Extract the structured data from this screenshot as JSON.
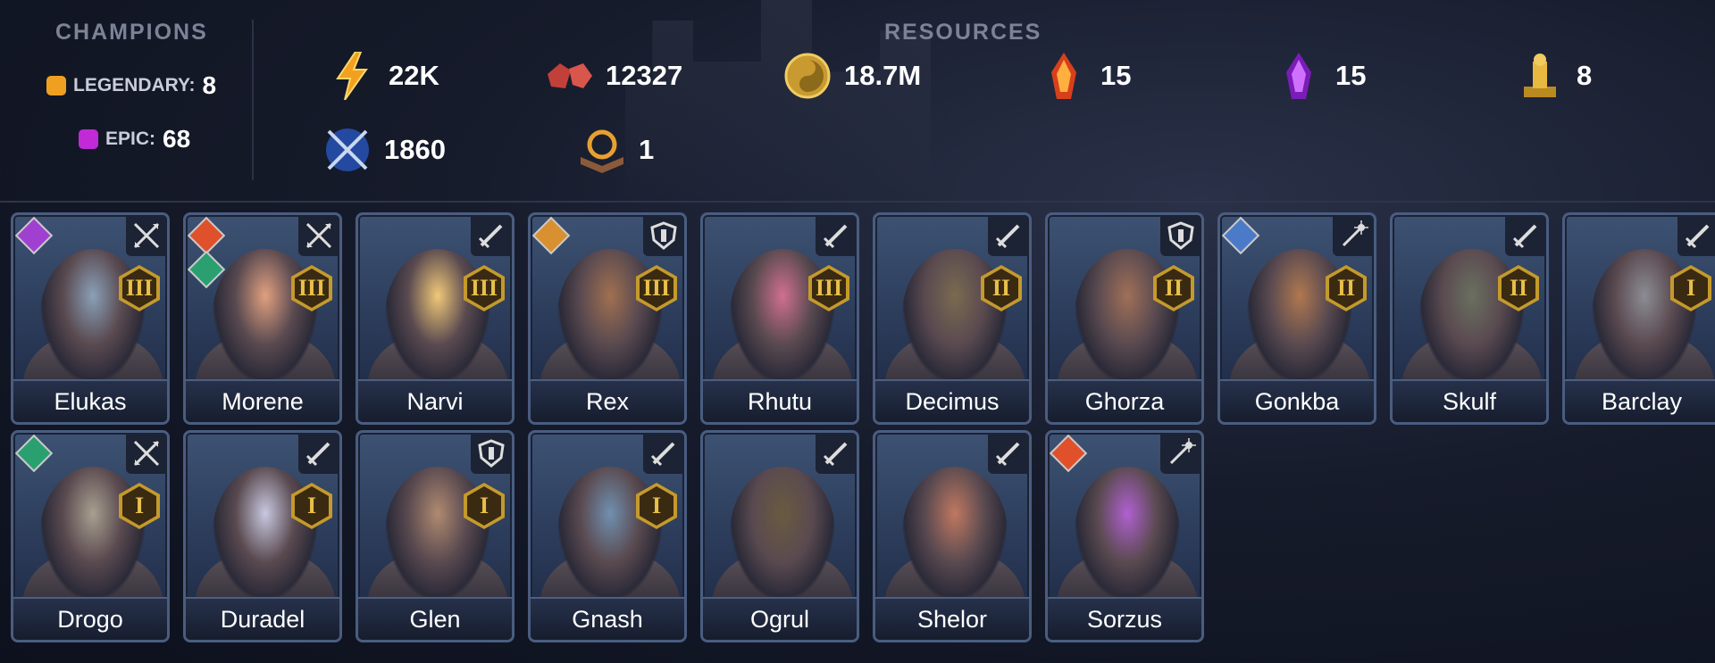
{
  "champions": {
    "title": "CHAMPIONS",
    "legendary_label": "LEGENDARY:",
    "legendary_count": "8",
    "epic_label": "EPIC:",
    "epic_count": "68",
    "legendary_color": "#f0a020",
    "epic_color": "#c22ad8"
  },
  "resources": {
    "title": "RESOURCES",
    "items": [
      {
        "icon": "energy-lightning-icon",
        "value": "22K"
      },
      {
        "icon": "gems-icon",
        "value": "12327"
      },
      {
        "icon": "silver-coin-icon",
        "value": "18.7M"
      },
      {
        "icon": "fire-shard-icon",
        "value": "15"
      },
      {
        "icon": "purple-shard-icon",
        "value": "15"
      },
      {
        "icon": "gold-statue-icon",
        "value": "8"
      },
      {
        "icon": "arena-token-icon",
        "value": "1860"
      },
      {
        "icon": "tome-icon",
        "value": "1"
      }
    ]
  },
  "cards": [
    {
      "name": "Elukas",
      "rank": "III",
      "role": "attack-icon",
      "affinity": [
        "void"
      ]
    },
    {
      "name": "Morene",
      "rank": "III",
      "role": "attack-icon",
      "affinity": [
        "force",
        "magic"
      ]
    },
    {
      "name": "Narvi",
      "rank": "III",
      "role": "sword-icon",
      "affinity": []
    },
    {
      "name": "Rex",
      "rank": "III",
      "role": "shield-icon",
      "affinity": [
        "spirit"
      ]
    },
    {
      "name": "Rhutu",
      "rank": "III",
      "role": "sword-icon",
      "affinity": []
    },
    {
      "name": "Decimus",
      "rank": "II",
      "role": "sword-icon",
      "affinity": []
    },
    {
      "name": "Ghorza",
      "rank": "II",
      "role": "shield-icon",
      "affinity": []
    },
    {
      "name": "Gonkba",
      "rank": "II",
      "role": "wand-icon",
      "affinity": [
        "magic-blue"
      ]
    },
    {
      "name": "Skulf",
      "rank": "II",
      "role": "sword-icon",
      "affinity": []
    },
    {
      "name": "Barclay",
      "rank": "I",
      "role": "sword-icon",
      "affinity": []
    },
    {
      "name": "Drogo",
      "rank": "I",
      "role": "attack-icon",
      "affinity": [
        "magic"
      ]
    },
    {
      "name": "Duradel",
      "rank": "I",
      "role": "sword-icon",
      "affinity": []
    },
    {
      "name": "Glen",
      "rank": "I",
      "role": "shield-icon",
      "affinity": []
    },
    {
      "name": "Gnash",
      "rank": "I",
      "role": "sword-icon",
      "affinity": []
    },
    {
      "name": "Ogrul",
      "rank": "",
      "role": "sword-icon",
      "affinity": []
    },
    {
      "name": "Shelor",
      "rank": "",
      "role": "sword-icon",
      "affinity": []
    },
    {
      "name": "Sorzus",
      "rank": "",
      "role": "wand-icon",
      "affinity": [
        "force"
      ]
    }
  ]
}
